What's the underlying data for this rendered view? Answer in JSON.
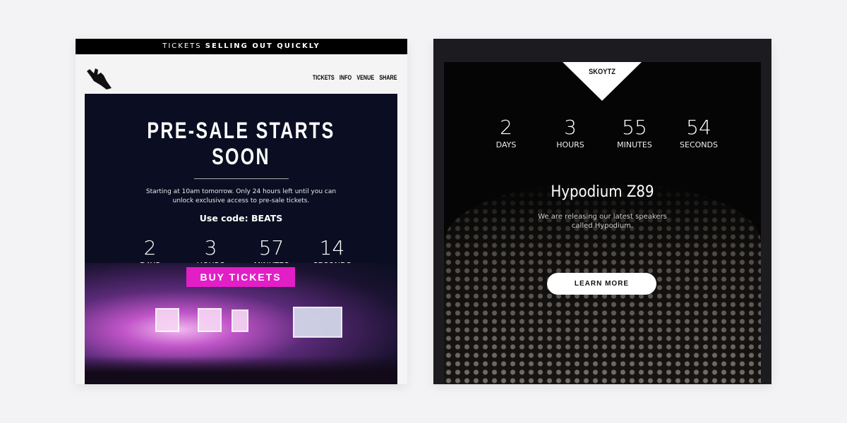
{
  "left_email": {
    "banner_light": "TICKETS",
    "banner_bold": "SELLING OUT QUICKLY",
    "logo_icon": "rock-hand-icon",
    "nav": [
      "TICKETS",
      "INFO",
      "VENUE",
      "SHARE"
    ],
    "title": "PRE-SALE STARTS SOON",
    "desc_line1": "Starting at 10am tomorrow. Only 24 hours left until you can",
    "desc_line2": "unlock exclusive access to pre-sale tickets.",
    "code": "Use code: BEATS",
    "countdown": [
      {
        "value": "2",
        "label": "DAYS"
      },
      {
        "value": "3",
        "label": "HOURS"
      },
      {
        "value": "57",
        "label": "MINUTES"
      },
      {
        "value": "14",
        "label": "SECONDS"
      }
    ],
    "button": "BUY TICKETS",
    "accent": "#e21fc6",
    "panel_color": "#0b0e22"
  },
  "right_email": {
    "brand": "SKOYTZ",
    "countdown": [
      {
        "value": "2",
        "label": "DAYS"
      },
      {
        "value": "3",
        "label": "HOURS"
      },
      {
        "value": "55",
        "label": "MINUTES"
      },
      {
        "value": "54",
        "label": "SECONDS"
      }
    ],
    "title": "Hypodium Z89",
    "desc_line1": "We are releasing our latest speakers",
    "desc_line2": "called Hypodium.",
    "button": "LEARN MORE"
  }
}
